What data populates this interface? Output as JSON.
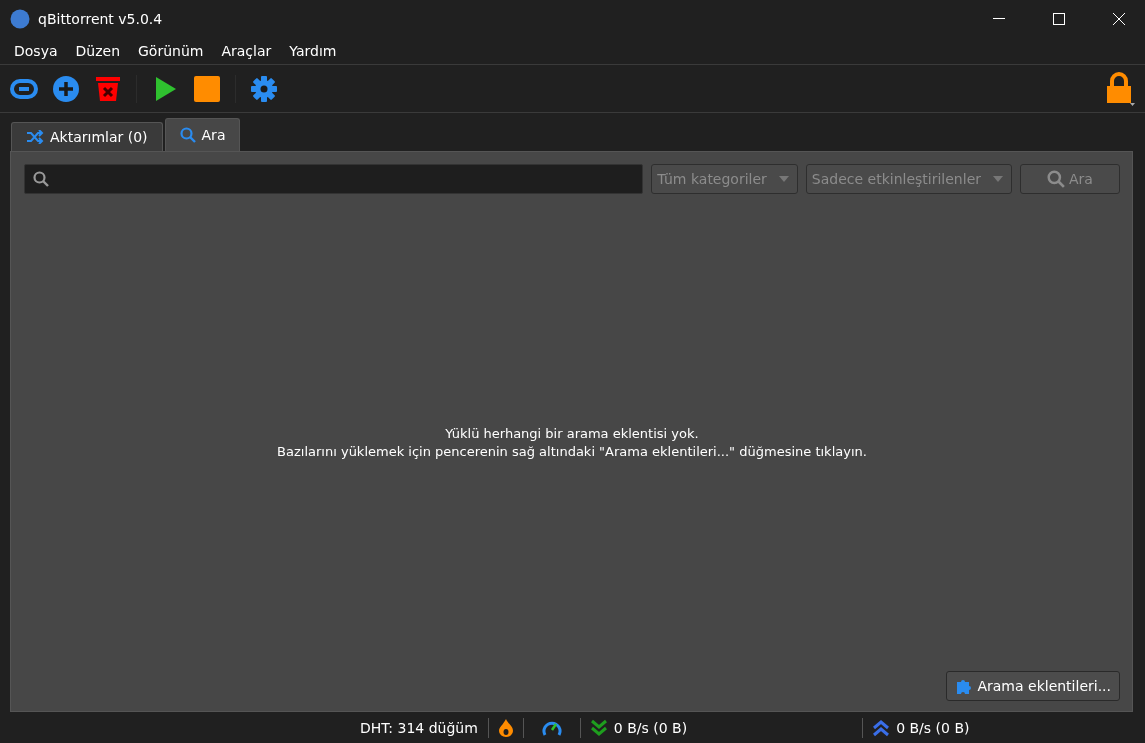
{
  "window": {
    "title": "qBittorrent v5.0.4"
  },
  "menu": [
    "Dosya",
    "Düzen",
    "Görünüm",
    "Araçlar",
    "Yardım"
  ],
  "tabs": [
    {
      "label": "Aktarımlar (0)",
      "selected": false,
      "kind": "transfers"
    },
    {
      "label": "Ara",
      "selected": true,
      "kind": "search"
    }
  ],
  "search": {
    "categories": "Tüm kategoriler",
    "plugins_filter": "Sadece etkinleştirilenler",
    "button": "Ara"
  },
  "message": [
    "Yüklü herhangi bir arama eklentisi yok.",
    "Bazılarını yüklemek için pencerenin sağ altındaki \"Arama eklentileri...\" düğmesine tıklayın."
  ],
  "plugins_button": "Arama eklentileri...",
  "status_bar": {
    "dht": "DHT: 314 düğüm",
    "download": "0 B/s (0 B)",
    "upload": "0 B/s (0 B)"
  }
}
